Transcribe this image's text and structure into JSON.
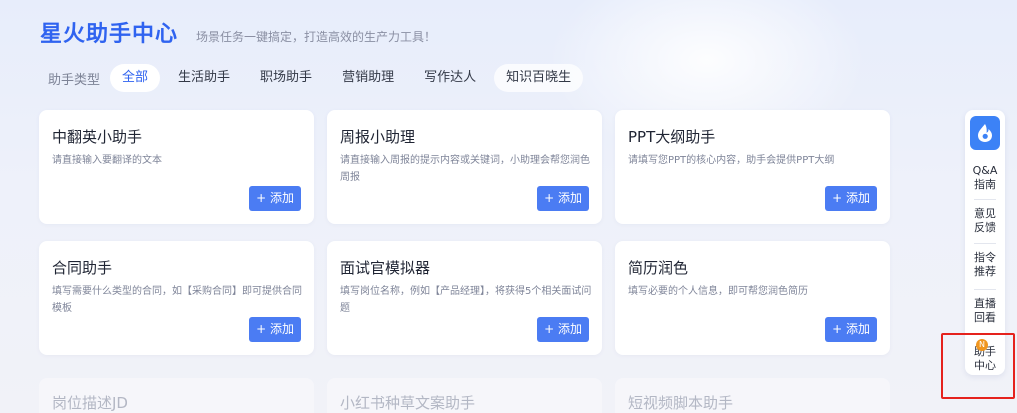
{
  "header": {
    "title": "星火助手中心",
    "subtitle": "场景任务一键搞定，打造高效的生产力工具！"
  },
  "types": {
    "label": "助手类型",
    "chips": [
      "全部",
      "生活助手",
      "职场助手",
      "营销助理",
      "写作达人",
      "知识百晓生"
    ]
  },
  "cards": [
    {
      "title": "中翻英小助手",
      "desc": "请直接输入要翻译的文本",
      "button": "+ 添加"
    },
    {
      "title": "周报小助理",
      "desc": "请直接输入周报的提示内容或关键词，小助理会帮您润色周报",
      "button": "+ 添加"
    },
    {
      "title": "PPT大纲助手",
      "desc": "请填写您PPT的核心内容，助手会提供PPT大纲",
      "button": "+ 添加"
    },
    {
      "title": "合同助手",
      "desc": "填写需要什么类型的合同，如【采购合同】即可提供合同模板",
      "button": "+ 添加"
    },
    {
      "title": "面试官模拟器",
      "desc": "填写岗位名称，例如【产品经理】，将获得5个相关面试问题",
      "button": "+ 添加"
    },
    {
      "title": "简历润色",
      "desc": "填写必要的个人信息，即可帮您润色简历",
      "button": "+ 添加"
    }
  ],
  "faded_cards": [
    "岗位描述JD",
    "小红书种草文案助手",
    "短视频脚本助手"
  ],
  "sidebar": {
    "items": [
      {
        "line1": "Q&A",
        "line2": "指南"
      },
      {
        "line1": "意见",
        "line2": "反馈"
      },
      {
        "line1": "指令",
        "line2": "推荐"
      },
      {
        "line1": "直播",
        "line2": "回看"
      },
      {
        "line1": "助手",
        "line2": "中心"
      }
    ],
    "badge": "N",
    "logo_color": "#3c82f6",
    "highlight_color": "#e5221d"
  }
}
